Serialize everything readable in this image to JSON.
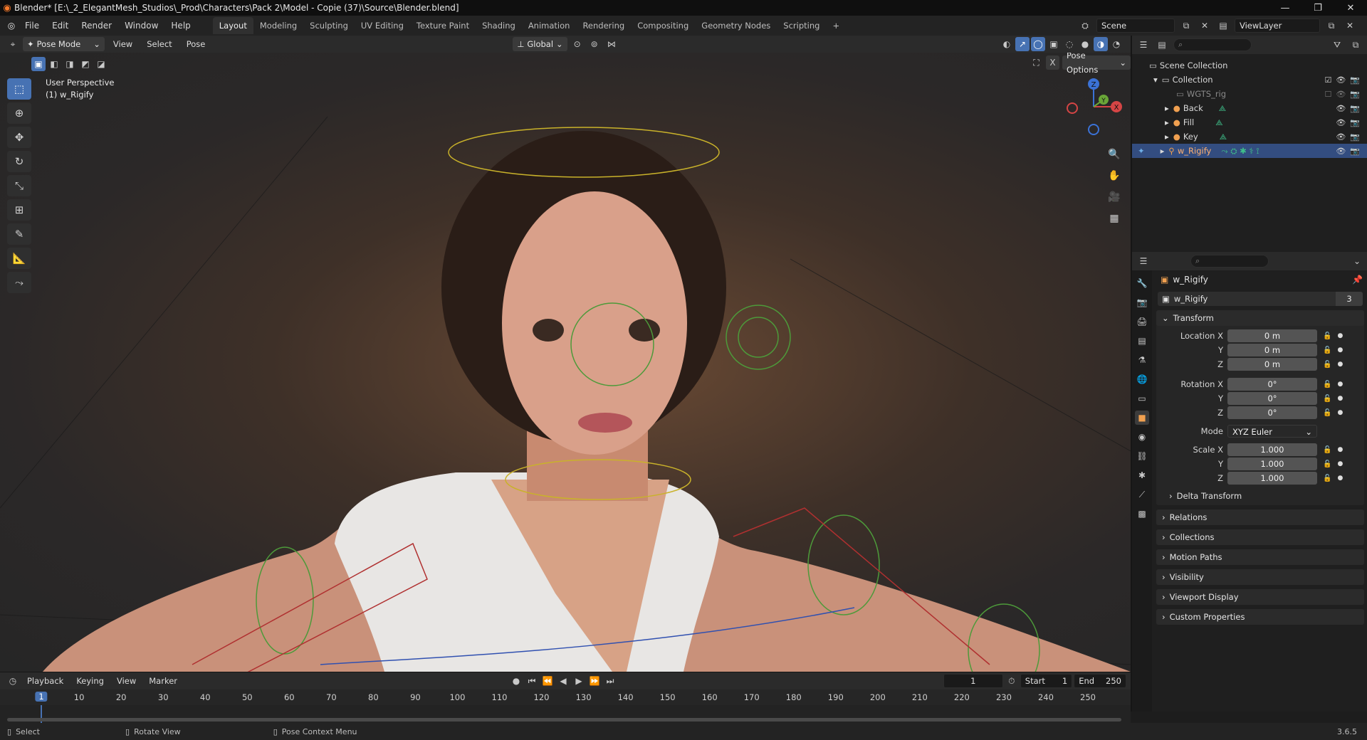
{
  "window": {
    "title": "Blender* [E:\\_2_ElegantMesh_Studios\\_Prod\\Characters\\Pack 2\\Model - Copie (37)\\Source\\Blender.blend]",
    "minimize": "—",
    "maximize": "❐",
    "close": "✕"
  },
  "menu": [
    "File",
    "Edit",
    "Render",
    "Window",
    "Help"
  ],
  "workspaces": [
    {
      "label": "Layout",
      "active": true
    },
    {
      "label": "Modeling"
    },
    {
      "label": "Sculpting"
    },
    {
      "label": "UV Editing"
    },
    {
      "label": "Texture Paint"
    },
    {
      "label": "Shading"
    },
    {
      "label": "Animation"
    },
    {
      "label": "Rendering"
    },
    {
      "label": "Compositing"
    },
    {
      "label": "Geometry Nodes"
    },
    {
      "label": "Scripting"
    }
  ],
  "add_workspace": "+",
  "scene": {
    "name": "Scene",
    "view_layer": "ViewLayer"
  },
  "viewport_header": {
    "mode": "Pose Mode",
    "menus": [
      "View",
      "Select",
      "Pose"
    ],
    "orientation": "Global",
    "pose_options": "Pose Options"
  },
  "viewport": {
    "perspective": "User Perspective",
    "active_object": "(1) w_Rigify"
  },
  "gizmo": {
    "x": "X",
    "y": "Y",
    "z": "Z"
  },
  "outliner": {
    "search_placeholder": "",
    "rows": [
      {
        "label": "Scene Collection"
      },
      {
        "label": "Collection"
      },
      {
        "label": "WGTS_rig"
      },
      {
        "label": "Back"
      },
      {
        "label": "Fill"
      },
      {
        "label": "Key"
      },
      {
        "label": "w_Rigify",
        "selected": true
      }
    ]
  },
  "properties": {
    "object_name": "w_Rigify",
    "data_name": "w_Rigify",
    "data_users": "3",
    "transform": {
      "title": "Transform",
      "location": {
        "label": "Location X",
        "x": "0 m",
        "y": "0 m",
        "z": "0 m"
      },
      "rotation": {
        "label": "Rotation X",
        "x": "0°",
        "y": "0°",
        "z": "0°"
      },
      "mode_label": "Mode",
      "mode_value": "XYZ Euler",
      "scale": {
        "label": "Scale X",
        "x": "1.000",
        "y": "1.000",
        "z": "1.000"
      },
      "axis_y": "Y",
      "axis_z": "Z",
      "delta": "Delta Transform"
    },
    "sections": [
      "Relations",
      "Collections",
      "Motion Paths",
      "Visibility",
      "Viewport Display",
      "Custom Properties"
    ]
  },
  "timeline": {
    "menus": [
      "Playback",
      "Keying",
      "View",
      "Marker"
    ],
    "current_frame": "1",
    "start_label": "Start",
    "start": "1",
    "end_label": "End",
    "end": "250",
    "ticks": [
      "10",
      "20",
      "30",
      "40",
      "50",
      "60",
      "70",
      "80",
      "90",
      "100",
      "110",
      "120",
      "130",
      "140",
      "150",
      "160",
      "170",
      "180",
      "190",
      "200",
      "210",
      "220",
      "230",
      "240",
      "250"
    ]
  },
  "statusbar": {
    "select": "Select",
    "rotate": "Rotate View",
    "context": "Pose Context Menu",
    "version": "3.6.5"
  },
  "colors": {
    "accent": "#4772b3",
    "selected_row": "#334d80",
    "orange": "#f5792a"
  }
}
